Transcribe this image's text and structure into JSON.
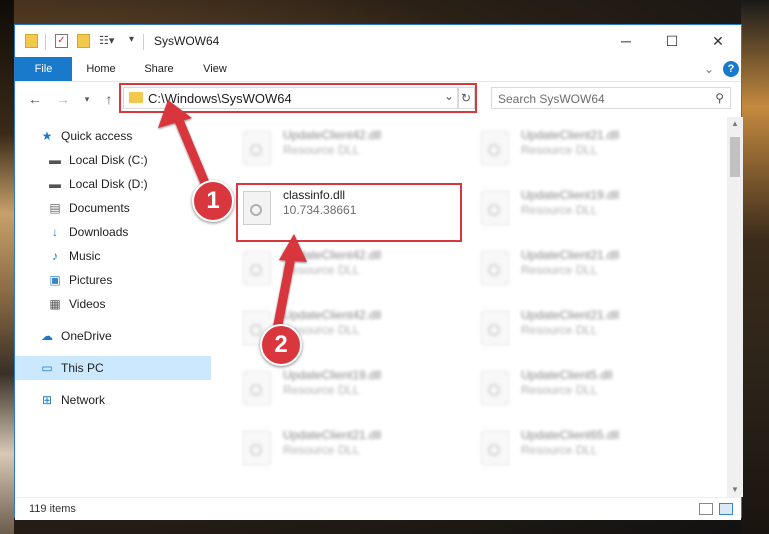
{
  "window": {
    "title": "SysWOW64",
    "minimize_label": "─",
    "maximize_label": "☐",
    "close_label": "✕"
  },
  "ribbon": {
    "tabs": [
      {
        "label": "File"
      },
      {
        "label": "Home"
      },
      {
        "label": "Share"
      },
      {
        "label": "View"
      }
    ],
    "help_label": "?",
    "expand_label": "⌄"
  },
  "address": {
    "path": "C:\\Windows\\SysWOW64",
    "search_placeholder": "Search SysWOW64"
  },
  "nav_pane": {
    "items": [
      {
        "label": "Quick access",
        "icon": "star-icon"
      },
      {
        "label": "Local Disk (C:)",
        "icon": "drive-icon"
      },
      {
        "label": "Local Disk (D:)",
        "icon": "drive-icon"
      },
      {
        "label": "Documents",
        "icon": "documents-icon"
      },
      {
        "label": "Downloads",
        "icon": "download-icon"
      },
      {
        "label": "Music",
        "icon": "music-icon"
      },
      {
        "label": "Pictures",
        "icon": "pictures-icon"
      },
      {
        "label": "Videos",
        "icon": "videos-icon"
      },
      {
        "label": "OneDrive",
        "icon": "cloud-icon"
      },
      {
        "label": "This PC",
        "icon": "computer-icon"
      },
      {
        "label": "Network",
        "icon": "network-icon"
      }
    ]
  },
  "files": {
    "highlighted": {
      "name": "classinfo.dll",
      "description": "10.734.38661"
    },
    "background": [
      {
        "name": "UpdateClient42.dll",
        "description": "Resource DLL"
      },
      {
        "name": "UpdateClient21.dll",
        "description": "Resource DLL"
      },
      {
        "name": "UpdateClient19.dll",
        "description": "Resource DLL"
      },
      {
        "name": "UpdateClient42.dll",
        "description": "Resource DLL"
      },
      {
        "name": "UpdateClient21.dll",
        "description": "Resource DLL"
      },
      {
        "name": "UpdateClient42.dll",
        "description": "Resource DLL"
      },
      {
        "name": "UpdateClient21.dll",
        "description": "Resource DLL"
      },
      {
        "name": "UpdateClient19.dll",
        "description": "Resource DLL"
      },
      {
        "name": "UpdateClient5.dll",
        "description": "Resource DLL"
      },
      {
        "name": "UpdateClient21.dll",
        "description": "Resource DLL"
      },
      {
        "name": "UpdateClient65.dll",
        "description": "Resource DLL"
      }
    ]
  },
  "status": {
    "item_count": "119 items"
  },
  "annotations": {
    "step1": "1",
    "step2": "2"
  },
  "colors": {
    "accent": "#1979ca",
    "highlight_red": "#d9363e",
    "selection": "#cce8ff"
  }
}
